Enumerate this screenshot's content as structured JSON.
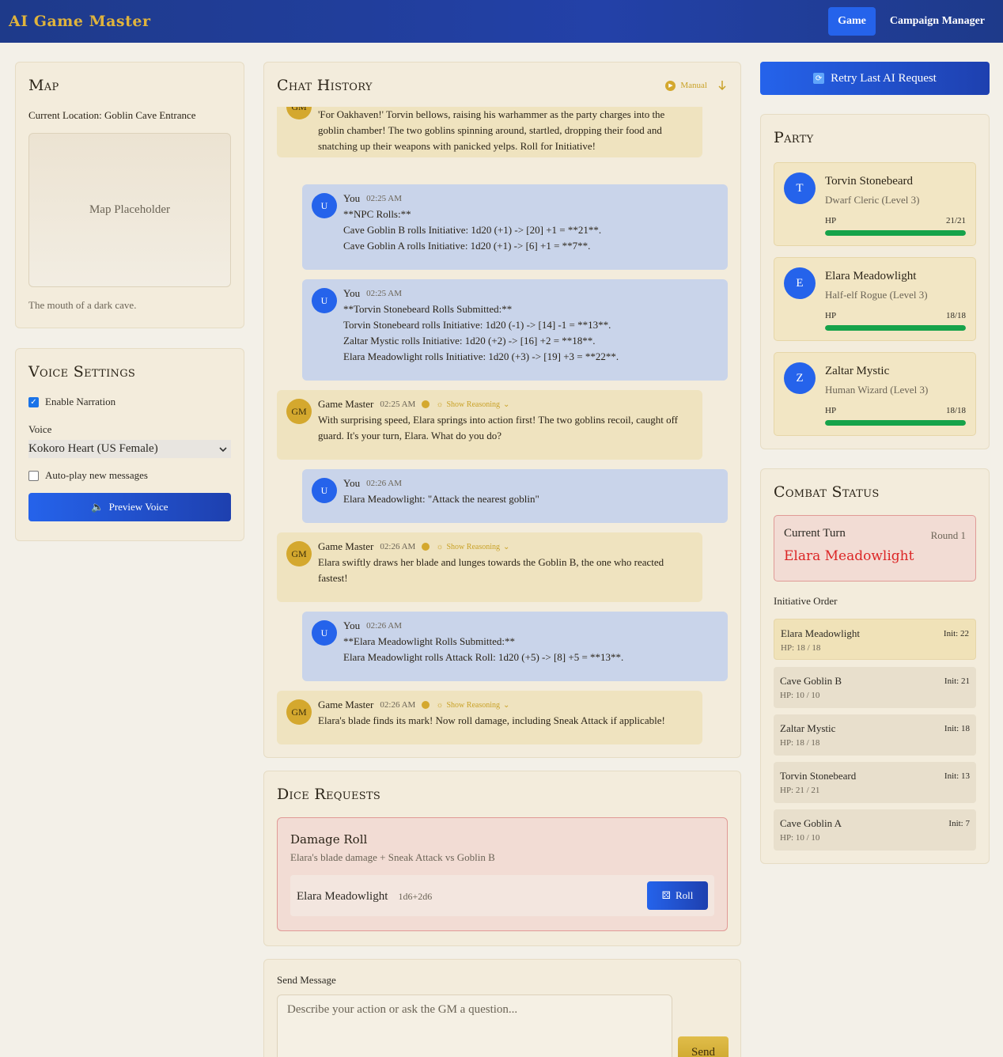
{
  "header": {
    "brand": "AI Game Master",
    "nav": [
      "Game",
      "Campaign Manager"
    ]
  },
  "map": {
    "title": "Map",
    "location": "Current Location: Goblin Cave Entrance",
    "placeholder": "Map Placeholder",
    "description": "The mouth of a dark cave."
  },
  "voice": {
    "title": "Voice Settings",
    "enable_narration": "Enable Narration",
    "voice_label": "Voice",
    "voice_selected": "Kokoro Heart (US Female)",
    "autoplay": "Auto-play new messages",
    "preview": "Preview Voice"
  },
  "chat": {
    "title": "Chat History",
    "manual": "Manual",
    "show_reasoning": "Show Reasoning",
    "messages": [
      {
        "role": "gm",
        "avatar": "GM",
        "author": "Game Master",
        "time": "",
        "body": "'For Oakhaven!' Torvin bellows, raising his warhammer as the party charges into the goblin chamber! The two goblins spinning around, startled, dropping their food and snatching up their weapons with panicked yelps. Roll for Initiative!"
      },
      {
        "role": "you",
        "avatar": "U",
        "author": "You",
        "time": "02:25 AM",
        "body": "**NPC Rolls:**\nCave Goblin B rolls Initiative: 1d20 (+1) -> [20] +1 = **21**.\nCave Goblin A rolls Initiative: 1d20 (+1) -> [6] +1 = **7**."
      },
      {
        "role": "you",
        "avatar": "U",
        "author": "You",
        "time": "02:25 AM",
        "body": "**Torvin Stonebeard Rolls Submitted:**\nTorvin Stonebeard rolls Initiative: 1d20 (-1) -> [14] -1 = **13**.\nZaltar Mystic rolls Initiative: 1d20 (+2) -> [16] +2 = **18**.\nElara Meadowlight rolls Initiative: 1d20 (+3) -> [19] +3 = **22**."
      },
      {
        "role": "gm",
        "avatar": "GM",
        "author": "Game Master",
        "time": "02:25 AM",
        "body": "With surprising speed, Elara springs into action first! The two goblins recoil, caught off guard. It's your turn, Elara. What do you do?"
      },
      {
        "role": "you",
        "avatar": "U",
        "author": "You",
        "time": "02:26 AM",
        "body": "Elara Meadowlight: \"Attack the nearest goblin\""
      },
      {
        "role": "gm",
        "avatar": "GM",
        "author": "Game Master",
        "time": "02:26 AM",
        "body": "Elara swiftly draws her blade and lunges towards the Goblin B, the one who reacted fastest!"
      },
      {
        "role": "you",
        "avatar": "U",
        "author": "You",
        "time": "02:26 AM",
        "body": "**Elara Meadowlight Rolls Submitted:**\nElara Meadowlight rolls Attack Roll: 1d20 (+5) -> [8] +5 = **13**."
      },
      {
        "role": "gm",
        "avatar": "GM",
        "author": "Game Master",
        "time": "02:26 AM",
        "body": "Elara's blade finds its mark! Now roll damage, including Sneak Attack if applicable!"
      }
    ]
  },
  "dice": {
    "title": "Dice Requests",
    "request_title": "Damage Roll",
    "request_desc": "Elara's blade damage + Sneak Attack vs Goblin B",
    "character": "Elara Meadowlight",
    "formula": "1d6+2d6",
    "roll": "Roll"
  },
  "send": {
    "label": "Send Message",
    "placeholder": "Describe your action or ask the GM a question...",
    "button": "Send"
  },
  "retry": "Retry Last AI Request",
  "party": {
    "title": "Party",
    "hp_label": "HP",
    "members": [
      {
        "initial": "T",
        "name": "Torvin Stonebeard",
        "class": "Dwarf Cleric (Level 3)",
        "hp": "21/21",
        "hp_fraction": 1.0
      },
      {
        "initial": "E",
        "name": "Elara Meadowlight",
        "class": "Half-elf Rogue (Level 3)",
        "hp": "18/18",
        "hp_fraction": 1.0
      },
      {
        "initial": "Z",
        "name": "Zaltar Mystic",
        "class": "Human Wizard (Level 3)",
        "hp": "18/18",
        "hp_fraction": 1.0
      }
    ]
  },
  "combat": {
    "title": "Combat Status",
    "current_turn_label": "Current Turn",
    "round": "Round 1",
    "current_name": "Elara Meadowlight",
    "initiative_label": "Initiative Order",
    "order": [
      {
        "name": "Elara Meadowlight",
        "hp": "HP: 18 / 18",
        "init": "Init: 22"
      },
      {
        "name": "Cave Goblin B",
        "hp": "HP: 10 / 10",
        "init": "Init: 21"
      },
      {
        "name": "Zaltar Mystic",
        "hp": "HP: 18 / 18",
        "init": "Init: 18"
      },
      {
        "name": "Torvin Stonebeard",
        "hp": "HP: 21 / 21",
        "init": "Init: 13"
      },
      {
        "name": "Cave Goblin A",
        "hp": "HP: 10 / 10",
        "init": "Init: 7"
      }
    ]
  }
}
